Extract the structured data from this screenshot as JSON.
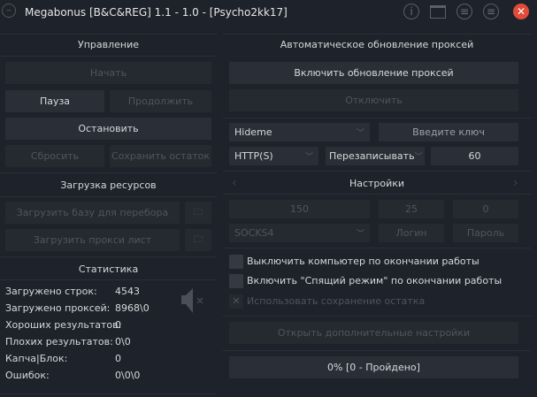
{
  "window": {
    "title": "Megabonus [B&C&REG] 1.1 - 1.0 - [Psycho2kk17]",
    "icons": [
      "app-logo-icon",
      "info-icon",
      "folder-icon",
      "menu-icon",
      "menu-icon",
      "close-icon"
    ],
    "close_color": "#e04b3a"
  },
  "control": {
    "header": "Управление",
    "start": "Начать",
    "pause": "Пауза",
    "resume": "Продолжить",
    "stop": "Остановить",
    "reset": "Сбросить",
    "save_rest": "Сохранить остаток"
  },
  "resources": {
    "header": "Загрузка ресурсов",
    "load_base": "Загрузить базу для перебора",
    "load_proxy": "Загрузить прокси лист"
  },
  "stats": {
    "header": "Статистика",
    "rows": [
      {
        "label": "Загружено строк:",
        "value": "4543"
      },
      {
        "label": "Загружено проксей:",
        "value": "8968\\0"
      },
      {
        "label": "Хороших результатов:",
        "value": "0"
      },
      {
        "label": "Плохих результатов:",
        "value": "0\\0"
      },
      {
        "label": "Капча|Блок:",
        "value": "0"
      },
      {
        "label": "Ошибок:",
        "value": "0\\0\\0"
      }
    ],
    "sound_icon": "speaker-muted-icon"
  },
  "proxy_update": {
    "header": "Автоматическое обновление проксей",
    "enable": "Включить обновление проксей",
    "disable": "Отключить",
    "source": "Hideme",
    "key_placeholder": "Введите ключ",
    "type": "HTTP(S)",
    "mode": "Перезаписывать",
    "interval": "60"
  },
  "settings": {
    "header": "Настройки",
    "threads": "150",
    "timeout": "25",
    "retries": "0",
    "proxy_type": "SOCKS4",
    "login": "Логин",
    "password": "Пароль",
    "checkboxes": [
      {
        "label": "Выключить компьютер по окончании работы",
        "checked": false,
        "enabled": true
      },
      {
        "label": "Включить \"Спящий режим\" по окончании работы",
        "checked": false,
        "enabled": true
      },
      {
        "label": "Использовать сохранение остатка",
        "checked": true,
        "enabled": false
      }
    ],
    "more": "Открыть дополнительные настройки"
  },
  "progress": {
    "text": "0% [0 - Пройдено]",
    "percent": 0
  }
}
